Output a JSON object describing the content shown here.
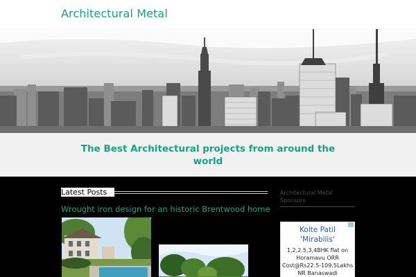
{
  "site": {
    "title": "Architectural Metal",
    "tagline": "The Best Architectural projects from around the world"
  },
  "hero": {
    "image": "city-skyline-image"
  },
  "main": {
    "section_heading": "Latest Posts",
    "posts": [
      {
        "title": "Wrought iron design for an historic Brentwood home"
      }
    ]
  },
  "sidebar": {
    "heading": "Architectural Metal Sponsors",
    "ad": {
      "title_line1": "Kolte Patil",
      "title_line2": "'Mirabilis'",
      "body_lines": [
        "1,2,2.5,3,4BHK flat on",
        "Horamavu ORR",
        "Cost@Rs22.5-109.5Lakhs",
        "NR Banaswadi"
      ]
    }
  },
  "colors": {
    "accent": "#16a383",
    "content_bg": "#000000",
    "band_bg": "#f1f1f1",
    "ad_link": "#1a5fbd"
  }
}
